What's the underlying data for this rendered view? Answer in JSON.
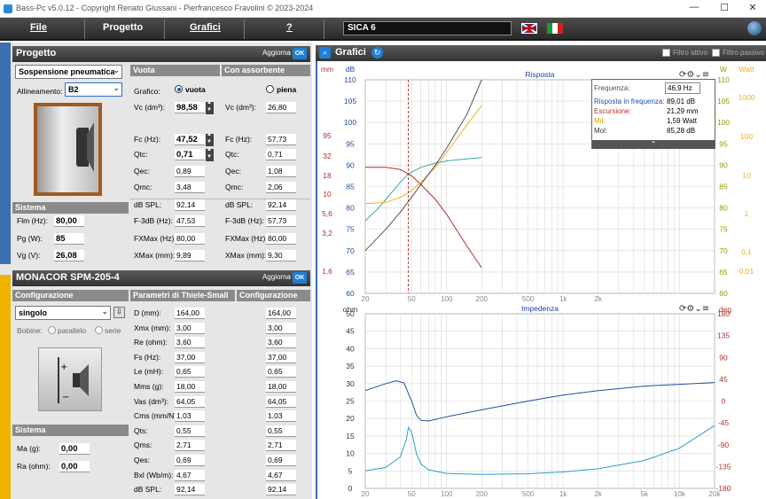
{
  "window": {
    "title": "Bass-Pc v5.0.12 - Copyright Renato Giussani - Pierfrancesco Fravolini © 2023-2024",
    "min": "—",
    "max": "☐",
    "close": "✕"
  },
  "menu": {
    "file": "File",
    "progetto": "Progetto",
    "grafici": "Grafici",
    "help": "?"
  },
  "project_name": "SICA 6",
  "progetto": {
    "title": "Progetto",
    "aggiorna": "Aggiorna",
    "ok": "OK",
    "suspension": "Sospensione pneumatica",
    "allineamento_label": "Allineamento:",
    "allineamento": "B2",
    "vuota_header": "Vuota",
    "assorbente_header": "Con assorbente",
    "grafico_label": "Grafico:",
    "vuota_radio": "vuota",
    "piena_radio": "piena",
    "rows_vuota": [
      {
        "label": "Vc (dm³):",
        "value": "98,58"
      },
      {
        "label": "Fc (Hz):",
        "value": "47,52"
      },
      {
        "label": "Qtc:",
        "value": "0,71"
      },
      {
        "label": "Qec:",
        "value": "0,89"
      },
      {
        "label": "Qmc:",
        "value": "3,48"
      },
      {
        "label": "dB SPL:",
        "value": "92,14"
      },
      {
        "label": "F-3dB (Hz):",
        "value": "47,53"
      },
      {
        "label": "FXMax (Hz):",
        "value": "80,00"
      },
      {
        "label": "XMax (mm):",
        "value": "9,89"
      }
    ],
    "rows_assorb": [
      {
        "label": "Vc (dm³):",
        "value": "26,80"
      },
      {
        "label": "Fc (Hz):",
        "value": "57,73"
      },
      {
        "label": "Qtc:",
        "value": "0,71"
      },
      {
        "label": "Qec:",
        "value": "1,08"
      },
      {
        "label": "Qmc:",
        "value": "2,06"
      },
      {
        "label": "dB SPL:",
        "value": "92,14"
      },
      {
        "label": "F-3dB (Hz):",
        "value": "57,73"
      },
      {
        "label": "FXMax (Hz):",
        "value": "80,00"
      },
      {
        "label": "XMax (mm):",
        "value": "9,30"
      }
    ],
    "sistema_header": "Sistema",
    "sistema": [
      {
        "label": "Flm (Hz):",
        "value": "80,00"
      },
      {
        "label": "Pg (W):",
        "value": "85"
      },
      {
        "label": "Vg (V):",
        "value": "26,08"
      }
    ]
  },
  "driver": {
    "title": "MONACOR SPM-205-4",
    "aggiorna": "Aggiorna",
    "ok": "OK",
    "config_header": "Configurazione",
    "ts_header": "Parametri di Thiele-Small",
    "config2_header": "Configurazione",
    "config_value": "singolo",
    "bobine_label": "Bobine:",
    "parallelo": "parallelo",
    "serie": "serie",
    "ts": [
      {
        "label": "D (mm):",
        "v1": "164,00",
        "v2": "164,00"
      },
      {
        "label": "Xmx (mm):",
        "v1": "3,00",
        "v2": "3,00"
      },
      {
        "label": "Re (ohm):",
        "v1": "3,60",
        "v2": "3,60"
      },
      {
        "label": "Fs (Hz):",
        "v1": "37,00",
        "v2": "37,00"
      },
      {
        "label": "Le (mH):",
        "v1": "0,65",
        "v2": "0,65"
      },
      {
        "label": "Mms (g):",
        "v1": "18,00",
        "v2": "18,00"
      },
      {
        "label": "Vas (dm³):",
        "v1": "64,05",
        "v2": "64,05"
      },
      {
        "label": "Cms (mm/N):",
        "v1": "1,03",
        "v2": "1,03"
      },
      {
        "label": "Qts:",
        "v1": "0,55",
        "v2": "0,55"
      },
      {
        "label": "Qms:",
        "v1": "2,71",
        "v2": "2,71"
      },
      {
        "label": "Qes:",
        "v1": "0,69",
        "v2": "0,69"
      },
      {
        "label": "Bxl (Wb/m):",
        "v1": "4,67",
        "v2": "4,67"
      },
      {
        "label": "dB SPL:",
        "v1": "92,14",
        "v2": "92,14"
      }
    ],
    "sistema_header": "Sistema",
    "sistema": [
      {
        "label": "Ma (g):",
        "value": "0,00"
      },
      {
        "label": "Ra (ohm):",
        "value": "0,00"
      }
    ]
  },
  "grafici": {
    "title": "Grafici",
    "filtro_attivo": "Filtro attivo",
    "filtro_passivo": "Filtro passivo",
    "colors": {
      "grid": "#d9d9d9",
      "blue": "#1f4fa0",
      "red": "#b03030",
      "olive": "#9a9a00",
      "yellow": "#f0b020",
      "cyan": "#2aa0c8",
      "gray": "#555555",
      "teal": "#3aa8a8"
    },
    "tooltip": {
      "freq_label": "Frequenza:",
      "freq_value": "46,9 Hz",
      "rows": [
        {
          "label": "Risposta in frequenza:",
          "value": "89,01 dB",
          "color": "#1f4fa0"
        },
        {
          "label": "Escursione:",
          "value": "21,29 mm",
          "color": "#b03030"
        },
        {
          "label": "Mil:",
          "value": "1,59 Watt",
          "color": "#d6a000"
        },
        {
          "label": "Mol:",
          "value": "85,28 dB",
          "color": "#333333"
        }
      ]
    }
  },
  "chart_data": [
    {
      "type": "line",
      "title": "Risposta",
      "x_scale": "log",
      "xlim": [
        20,
        20000
      ],
      "x_ticks": [
        "20",
        "50",
        "100",
        "200",
        "500",
        "1k",
        "2k"
      ],
      "left_axis_db": {
        "unit": "dB",
        "ticks": [
          "110",
          "105",
          "100",
          "95",
          "90",
          "85",
          "80",
          "75",
          "70",
          "65",
          "60"
        ]
      },
      "left_axis_mm": {
        "unit": "mm",
        "ticks": [
          "95",
          "32",
          "18",
          "10",
          "5,6",
          "3,2",
          "1,6"
        ]
      },
      "right_axis_w": {
        "unit": "W",
        "ticks": [
          "110",
          "105",
          "100",
          "95",
          "90",
          "85",
          "80",
          "75",
          "70",
          "65",
          "60"
        ]
      },
      "right_axis_watt": {
        "unit": "Watt",
        "ticks": [
          "1000",
          "100",
          "10",
          "1",
          "0,1",
          "0,01"
        ]
      },
      "ylim": [
        60,
        110
      ],
      "marker_x": 46.9,
      "series": [
        {
          "color": "teal",
          "x": [
            20,
            25,
            30,
            40,
            47,
            60,
            80,
            100,
            150,
            200
          ],
          "y": [
            77,
            79.5,
            82,
            86,
            88,
            89.5,
            90.5,
            91,
            91.5,
            91.8
          ]
        },
        {
          "color": "red",
          "x": [
            20,
            30,
            40,
            50,
            60,
            80,
            100,
            150,
            200
          ],
          "y": [
            89.5,
            89.5,
            89,
            87.5,
            85.5,
            82,
            78.5,
            71,
            66
          ]
        },
        {
          "color": "yellow",
          "x": [
            20,
            30,
            40,
            47,
            60,
            80,
            100,
            150,
            200
          ],
          "y": [
            81,
            81.3,
            82.5,
            83.5,
            86,
            89.5,
            93,
            99.5,
            104
          ]
        },
        {
          "color": "gray",
          "x": [
            20,
            30,
            40,
            50,
            60,
            80,
            100,
            150,
            200
          ],
          "y": [
            70,
            75,
            79,
            82.5,
            85.5,
            90,
            94,
            102,
            110
          ]
        }
      ]
    },
    {
      "type": "line",
      "title": "Impedenza",
      "x_scale": "log",
      "xlim": [
        20,
        20000
      ],
      "x_ticks": [
        "20",
        "50",
        "100",
        "200",
        "500",
        "1k",
        "2k",
        "5k",
        "10k",
        "20k"
      ],
      "left_axis": {
        "unit": "ohm",
        "ticks": [
          "50",
          "45",
          "40",
          "35",
          "30",
          "25",
          "20",
          "15",
          "10",
          "5",
          "0"
        ]
      },
      "right_axis": {
        "unit": "deg",
        "ticks": [
          "180",
          "135",
          "90",
          "45",
          "0",
          "-45",
          "-90",
          "-135",
          "-180"
        ]
      },
      "ylim": [
        0,
        50
      ],
      "series": [
        {
          "color": "blue",
          "axis": "ohm",
          "x": [
            20,
            30,
            37,
            43,
            50,
            55,
            60,
            70,
            100,
            200,
            500,
            1000,
            2000,
            5000,
            10000,
            20000
          ],
          "y": [
            28,
            30,
            30.8,
            30.2,
            25,
            21,
            19.5,
            19.3,
            20.5,
            22.5,
            25,
            26.7,
            28,
            29.3,
            29.8,
            30.3
          ]
        },
        {
          "color": "cyan",
          "axis": "ohm",
          "x": [
            20,
            30,
            40,
            45,
            47,
            50,
            55,
            60,
            70,
            100,
            200,
            500,
            1000,
            2000,
            5000,
            10000,
            20000
          ],
          "y": [
            5,
            6,
            9,
            14,
            17.5,
            16,
            10,
            7,
            5.3,
            4.3,
            4,
            4.2,
            4.7,
            5.6,
            8,
            11.5,
            18
          ]
        }
      ]
    }
  ]
}
